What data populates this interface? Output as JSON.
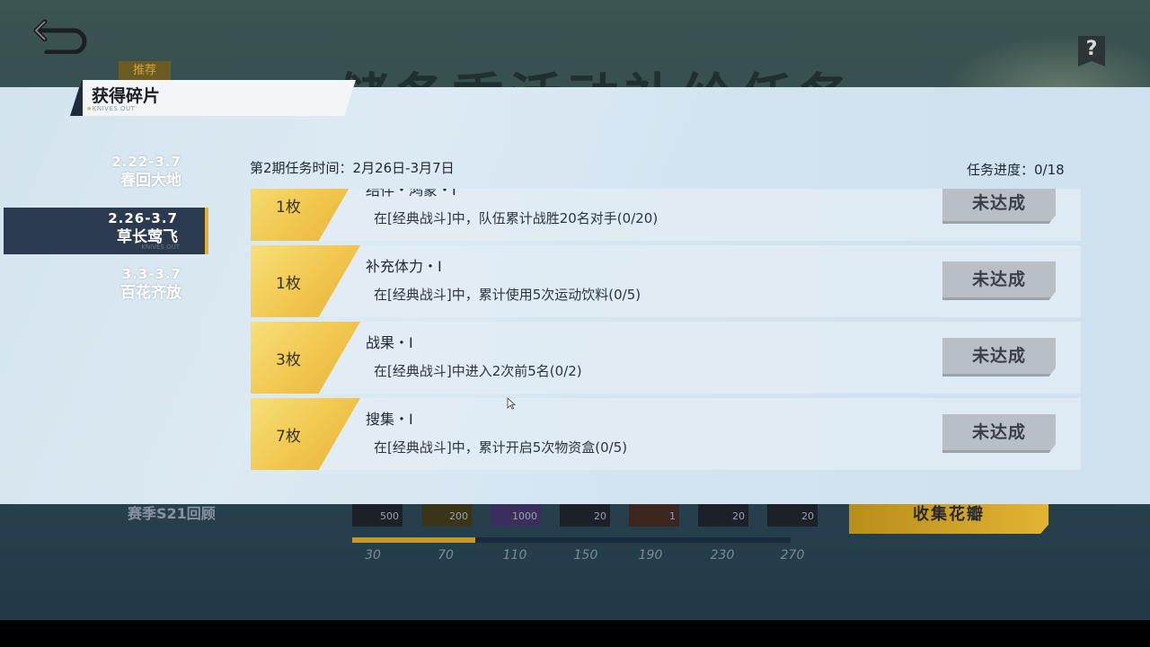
{
  "background": {
    "big_title": "储备季活动补给任务",
    "recommend_label": "推荐",
    "season_label": "赛季S21回顾",
    "collect_button": "收集花瓣",
    "rewards": [
      "500",
      "200",
      "1000",
      "20",
      "1",
      "20",
      "20"
    ],
    "reward_progress": 0.28,
    "tick_labels": [
      "30",
      "70",
      "110",
      "150",
      "190",
      "230",
      "270"
    ]
  },
  "modal": {
    "title": "获得碎片",
    "subtitle": "KNIVES OUT",
    "tabs": [
      {
        "date": "2.22-3.7",
        "name": "春回大地",
        "active": false
      },
      {
        "date": "2.26-3.7",
        "name": "草长莺飞",
        "active": true,
        "watermark": "KNIVES OUT"
      },
      {
        "date": "3.3-3.7",
        "name": "百花齐放",
        "active": false
      }
    ],
    "period_time": "第2期任务时间：2月26日-3月7日",
    "task_progress": "任务进度：0/18",
    "tasks": [
      {
        "badge": "1枚",
        "name": "结伴・鸿蒙・I",
        "desc": "在[经典战斗]中，队伍累计战胜20名对手(0/20)",
        "status": "未达成"
      },
      {
        "badge": "1枚",
        "name": "补充体力・I",
        "desc": "在[经典战斗]中，累计使用5次运动饮料(0/5)",
        "status": "未达成"
      },
      {
        "badge": "3枚",
        "name": "战果・I",
        "desc": "在[经典战斗]中进入2次前5名(0/2)",
        "status": "未达成"
      },
      {
        "badge": "7枚",
        "name": "搜集・I",
        "desc": "在[经典战斗]中，累计开启5次物资盒(0/5)",
        "status": "未达成"
      }
    ]
  },
  "colors": {
    "accent_gold": "#e2b232",
    "panel_bg": "#d4e4ef",
    "active_tab": "#2b3a4f",
    "button_disabled": "#b8bfc6"
  },
  "icons": {
    "back": "back-arrow-icon",
    "help": "help-icon",
    "cursor": "mouse-cursor-icon"
  }
}
